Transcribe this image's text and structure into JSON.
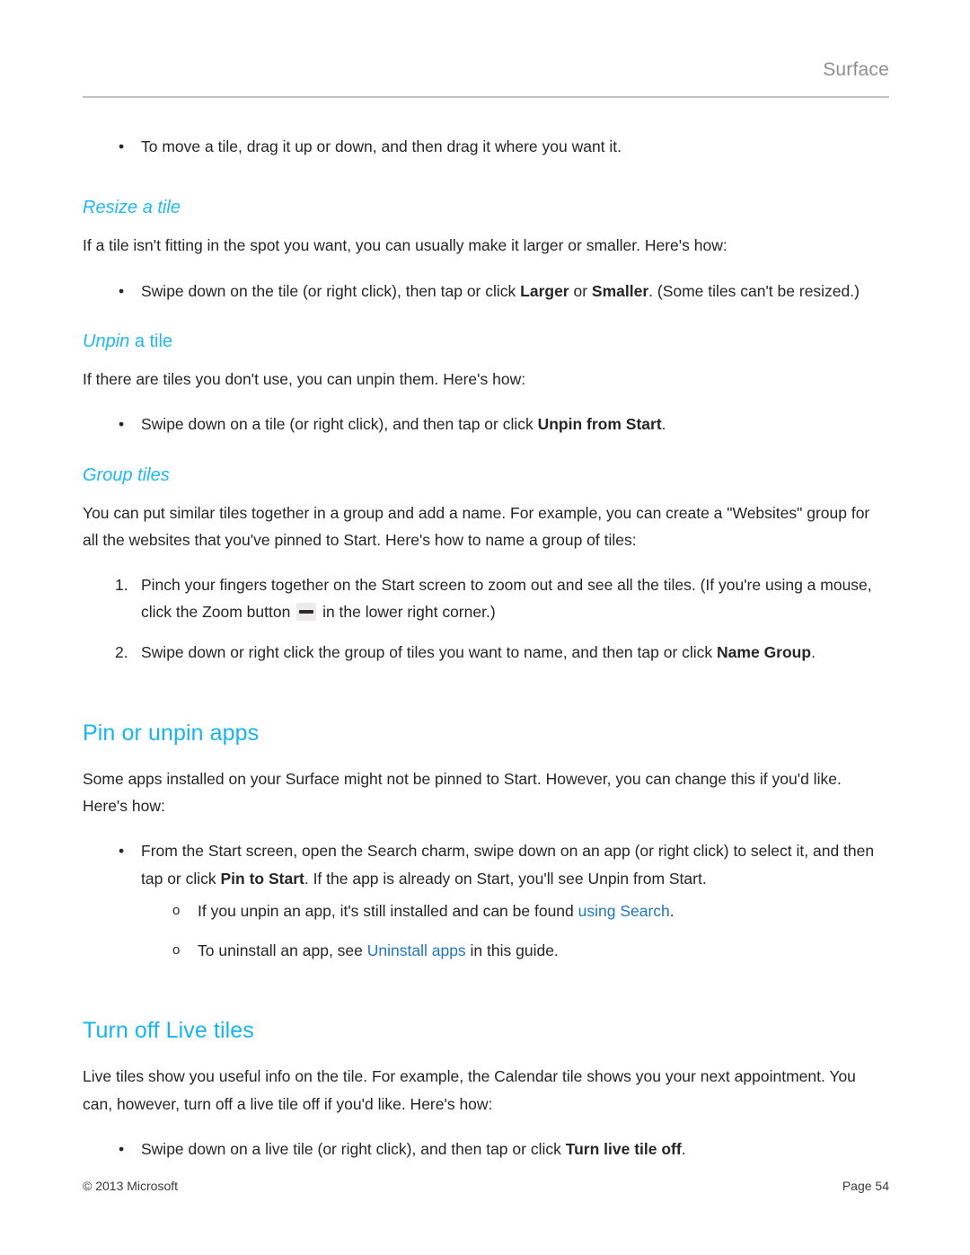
{
  "header": {
    "title": "Surface"
  },
  "footer": {
    "copyright": "© 2013 Microsoft",
    "page_number": "Page 54"
  },
  "colors": {
    "heading_blue": "#17b4f0",
    "subheading_blue": "#20b7f2",
    "link_blue": "#1f77c2",
    "header_gray": "#8e8e8e",
    "rule_gray": "#c3c3c3",
    "body_text": "#262626"
  },
  "content": {
    "move_tile_bullet": {
      "marker": "•",
      "text": "To move a tile, drag it up or down, and then drag it where you want it."
    },
    "resize_section": {
      "heading": "Resize a tile",
      "intro": "If a tile isn't fitting in the spot you want, you can usually make it larger or smaller. Here's how:",
      "bullet": {
        "marker": "•",
        "part1": "Swipe down on the tile (or right click), then tap or click ",
        "bold1": "Larger",
        "part2": " or ",
        "bold2": "Smaller",
        "part3": ". (Some tiles can't be resized.)"
      }
    },
    "unpin_section": {
      "heading_italic": "Unpin",
      "heading_upright": " a tile",
      "intro": "If there are tiles you don't use, you can unpin them. Here's how:",
      "bullet": {
        "marker": "•",
        "part1": "Swipe down on a tile (or right click), and then tap or click ",
        "bold1": "Unpin from Start",
        "part2": "."
      }
    },
    "group_section": {
      "heading": "Group tiles",
      "intro_line1": "You can put similar tiles together in a group and add a name.  For example, you can create a \"Websites\" group for",
      "intro_line2": "all the websites that you've pinned to Start. Here's how to name a group of tiles:",
      "steps": [
        {
          "marker": "1.",
          "part1": "Pinch your fingers together on the Start screen to zoom out and see all the tiles. (If you're using a mouse, click the Zoom button ",
          "icon": "zoom-out-button-icon",
          "part2": " in the lower right corner.)"
        },
        {
          "marker": "2.",
          "part1": "Swipe down or right click the group of tiles you want to name, and then tap or click ",
          "bold1": "Name Group",
          "part2": "."
        }
      ]
    },
    "pin_unpin_section": {
      "heading": "Pin or unpin apps",
      "intro": "Some apps installed on your Surface might not be pinned to Start. However, you can change this if you'd like. Here's how:",
      "bullet": {
        "marker": "•",
        "part1": "From the Start screen, open the Search charm, swipe down on an app (or right click) to select it, and then tap or click ",
        "bold1": "Pin to Start",
        "part2": ". If the app is already on Start, you'll see Unpin from Start."
      },
      "sub_bullets": [
        {
          "marker": "o",
          "part1": "If you unpin an app, it's still installed and can be found ",
          "link": "using Search",
          "part2": "."
        },
        {
          "marker": "o",
          "part1": "To uninstall an app, see ",
          "link": "Uninstall apps",
          "part2": " in this guide."
        }
      ]
    },
    "live_tiles_section": {
      "heading": "Turn off Live tiles",
      "intro": "Live tiles show you useful info on the tile. For example, the Calendar tile shows you your next appointment. You can, however, turn off a live tile off if you'd like. Here's how:",
      "bullet": {
        "marker": "•",
        "part1": "Swipe down on a live tile (or right click), and then tap or click ",
        "bold1": "Turn live tile off",
        "part2": "."
      }
    }
  }
}
